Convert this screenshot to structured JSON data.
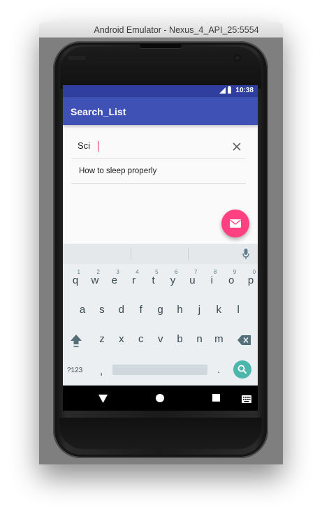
{
  "window": {
    "title": "Android Emulator - Nexus_4_API_25:5554"
  },
  "status_bar": {
    "time": "10:38",
    "signal_icon": "signal-icon",
    "battery_icon": "battery-icon"
  },
  "app_bar": {
    "title": "Search_List"
  },
  "search": {
    "value": "Sci",
    "clear_icon": "close-icon"
  },
  "results": [
    {
      "label": "How to sleep properly"
    }
  ],
  "fab": {
    "icon": "mail-icon",
    "color": "#ff4081"
  },
  "keyboard": {
    "row1": [
      {
        "k": "q",
        "hint": "1"
      },
      {
        "k": "w",
        "hint": "2"
      },
      {
        "k": "e",
        "hint": "3"
      },
      {
        "k": "r",
        "hint": "4"
      },
      {
        "k": "t",
        "hint": "5"
      },
      {
        "k": "y",
        "hint": "6"
      },
      {
        "k": "u",
        "hint": "7"
      },
      {
        "k": "i",
        "hint": "8"
      },
      {
        "k": "o",
        "hint": "9"
      },
      {
        "k": "p",
        "hint": "0"
      }
    ],
    "row2": [
      "a",
      "s",
      "d",
      "f",
      "g",
      "h",
      "j",
      "k",
      "l"
    ],
    "row3": [
      "z",
      "x",
      "c",
      "v",
      "b",
      "n",
      "m"
    ],
    "symbols_label": "?123",
    "comma": ",",
    "period": "."
  },
  "colors": {
    "primary": "#3f51b5",
    "primary_dark": "#303f9f",
    "accent": "#ff4081",
    "search_key": "#4db6ac"
  }
}
